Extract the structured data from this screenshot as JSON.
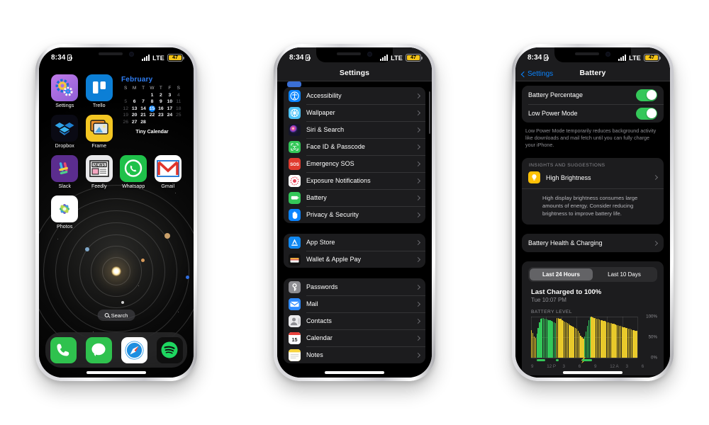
{
  "statusbar": {
    "time": "8:34",
    "carrier": "LTE",
    "battery_percent": "47",
    "lock_icon": "lock-icon"
  },
  "home": {
    "apps_row1": [
      {
        "label": "Settings",
        "icon": "settings-gears-icon"
      },
      {
        "label": "Trello",
        "icon": "trello-board-icon"
      }
    ],
    "apps_row2": [
      {
        "label": "Dropbox",
        "icon": "dropbox-box-icon"
      },
      {
        "label": "Frame",
        "icon": "frame-photos-icon"
      }
    ],
    "apps_row3": [
      {
        "label": "Slack",
        "icon": "slack-hash-icon"
      },
      {
        "label": "Feedly",
        "icon": "feedly-news-icon"
      },
      {
        "label": "Whatsapp",
        "icon": "whatsapp-phone-icon"
      },
      {
        "label": "Gmail",
        "icon": "gmail-envelope-icon"
      }
    ],
    "apps_row4": [
      {
        "label": "Photos",
        "icon": "photos-flower-icon"
      }
    ],
    "widget": {
      "caption": "Tiny Calendar",
      "month": "February",
      "dows": [
        "S",
        "M",
        "T",
        "W",
        "T",
        "F",
        "S"
      ],
      "weeks": [
        [
          {
            "d": "",
            "s": "blank"
          },
          {
            "d": "",
            "s": "blank"
          },
          {
            "d": "",
            "s": "blank"
          },
          {
            "d": "1",
            "s": "on"
          },
          {
            "d": "2",
            "s": "on"
          },
          {
            "d": "3",
            "s": "on"
          },
          {
            "d": "4",
            "s": "dim"
          }
        ],
        [
          {
            "d": "5",
            "s": "dim"
          },
          {
            "d": "6",
            "s": "on"
          },
          {
            "d": "7",
            "s": "on"
          },
          {
            "d": "8",
            "s": "on"
          },
          {
            "d": "9",
            "s": "on"
          },
          {
            "d": "10",
            "s": "on"
          },
          {
            "d": "11",
            "s": "dim"
          }
        ],
        [
          {
            "d": "12",
            "s": "dim"
          },
          {
            "d": "13",
            "s": "on"
          },
          {
            "d": "14",
            "s": "on"
          },
          {
            "d": "15",
            "s": "today"
          },
          {
            "d": "16",
            "s": "on"
          },
          {
            "d": "17",
            "s": "on"
          },
          {
            "d": "18",
            "s": "dim"
          }
        ],
        [
          {
            "d": "19",
            "s": "dim"
          },
          {
            "d": "20",
            "s": "on"
          },
          {
            "d": "21",
            "s": "on"
          },
          {
            "d": "22",
            "s": "on"
          },
          {
            "d": "23",
            "s": "on"
          },
          {
            "d": "24",
            "s": "on"
          },
          {
            "d": "25",
            "s": "dim"
          }
        ],
        [
          {
            "d": "26",
            "s": "dim"
          },
          {
            "d": "27",
            "s": "on"
          },
          {
            "d": "28",
            "s": "on"
          },
          {
            "d": "",
            "s": "blank"
          },
          {
            "d": "",
            "s": "blank"
          },
          {
            "d": "",
            "s": "blank"
          },
          {
            "d": "",
            "s": "blank"
          }
        ]
      ],
      "today": "15",
      "accent": "#0a84ff"
    },
    "search_label": "Search",
    "dock": [
      {
        "label": "Phone",
        "icon": "phone-icon"
      },
      {
        "label": "Messages",
        "icon": "messages-bubble-icon"
      },
      {
        "label": "Safari",
        "icon": "safari-compass-icon"
      },
      {
        "label": "Spotify",
        "icon": "spotify-icon"
      }
    ]
  },
  "settings": {
    "title": "Settings",
    "group1": [
      {
        "label": "Accessibility",
        "icon": "accessibility-icon",
        "color": "#0a84ff"
      },
      {
        "label": "Wallpaper",
        "icon": "wallpaper-icon",
        "color": "#4fc3f7"
      },
      {
        "label": "Siri & Search",
        "icon": "siri-icon",
        "color": "#1a1a2e"
      },
      {
        "label": "Face ID & Passcode",
        "icon": "faceid-icon",
        "color": "#34c759"
      },
      {
        "label": "Emergency SOS",
        "icon": "sos-icon",
        "color": "#e03b2f"
      },
      {
        "label": "Exposure Notifications",
        "icon": "exposure-notifications-icon",
        "color": "#ffffff"
      },
      {
        "label": "Battery",
        "icon": "battery-icon",
        "color": "#34c759"
      },
      {
        "label": "Privacy & Security",
        "icon": "privacy-hand-icon",
        "color": "#0a84ff"
      }
    ],
    "group2": [
      {
        "label": "App Store",
        "icon": "app-store-icon",
        "color": "#0a84ff"
      },
      {
        "label": "Wallet & Apple Pay",
        "icon": "wallet-icon",
        "color": "#1c1c1e"
      }
    ],
    "group3": [
      {
        "label": "Passwords",
        "icon": "passwords-key-icon",
        "color": "#8e8e93"
      },
      {
        "label": "Mail",
        "icon": "mail-icon",
        "color": "#2f8bff"
      },
      {
        "label": "Contacts",
        "icon": "contacts-icon",
        "color": "#b0b0b5"
      },
      {
        "label": "Calendar",
        "icon": "calendar-icon",
        "color": "#ffffff"
      },
      {
        "label": "Notes",
        "icon": "notes-icon",
        "color": "#ffd60a"
      }
    ]
  },
  "battery": {
    "back_label": "Settings",
    "title": "Battery",
    "toggles": [
      {
        "label": "Battery Percentage",
        "state": "on"
      },
      {
        "label": "Low Power Mode",
        "state": "on"
      }
    ],
    "footnote": "Low Power Mode temporarily reduces background activity like downloads and mail fetch until you can fully charge your iPhone.",
    "insights_header": "INSIGHTS AND SUGGESTIONS",
    "insight": {
      "icon": "lightbulb-icon",
      "title": "High Brightness",
      "body": "High display brightness consumes large amounts of energy. Consider reducing brightness to improve battery life."
    },
    "health_row": "Battery Health & Charging",
    "segments": [
      {
        "label": "Last 24 Hours",
        "active": true
      },
      {
        "label": "Last 10 Days",
        "active": false
      }
    ],
    "last_charged": "Last Charged to 100%",
    "last_charged_time": "Tue 10:07 PM",
    "chart_title": "BATTERY LEVEL",
    "colors": {
      "charging": "#34c759",
      "discharging": "#e8c92b",
      "toggle_on": "#34c759"
    }
  },
  "chart_data": {
    "type": "bar",
    "title": "BATTERY LEVEL",
    "xlabel": "",
    "ylabel": "",
    "ylim": [
      0,
      100
    ],
    "ytick_labels": [
      "100%",
      "50%",
      "0%"
    ],
    "ytick_values": [
      100,
      50,
      0
    ],
    "xtick_labels": [
      "9",
      "12 P",
      "3",
      "6",
      "9",
      "12 A",
      "3",
      "6"
    ],
    "grid": true,
    "legend": "none",
    "series": [
      {
        "name": "Battery level (%)",
        "values": [
          68,
          60,
          52,
          48,
          58,
          72,
          86,
          95,
          96,
          96,
          95,
          94,
          93,
          92,
          91,
          90,
          88,
          86,
          84,
          97,
          96,
          95,
          94,
          92,
          90,
          88,
          86,
          84,
          82,
          80,
          78,
          76,
          74,
          72,
          70,
          66,
          60,
          54,
          50,
          47,
          52,
          63,
          78,
          92,
          99,
          100,
          98,
          97,
          96,
          95,
          94,
          93,
          92,
          91,
          90,
          89,
          88,
          87,
          86,
          85,
          84,
          83,
          82,
          81,
          80,
          79,
          78,
          77,
          76,
          75,
          74,
          73,
          72,
          71,
          70,
          69,
          68,
          67,
          66,
          65
        ]
      },
      {
        "name": "Charging state",
        "values": [
          "d",
          "d",
          "d",
          "d",
          "c",
          "c",
          "c",
          "c",
          "c",
          "c",
          "c",
          "c",
          "c",
          "c",
          "c",
          "c",
          "c",
          "c",
          "c",
          "d",
          "d",
          "d",
          "d",
          "d",
          "d",
          "d",
          "d",
          "d",
          "d",
          "d",
          "d",
          "d",
          "d",
          "d",
          "d",
          "d",
          "d",
          "d",
          "d",
          "d",
          "c",
          "c",
          "c",
          "c",
          "c",
          "d",
          "d",
          "d",
          "d",
          "d",
          "d",
          "d",
          "d",
          "d",
          "d",
          "d",
          "d",
          "d",
          "d",
          "d",
          "d",
          "d",
          "d",
          "d",
          "d",
          "d",
          "d",
          "d",
          "d",
          "d",
          "d",
          "d",
          "d",
          "d",
          "d",
          "d",
          "d",
          "d",
          "d",
          "d"
        ]
      }
    ],
    "charge_marks": [
      {
        "start_pct": 5,
        "width_pct": 8
      },
      {
        "start_pct": 23,
        "width_pct": 3
      },
      {
        "start_pct": 48,
        "width_pct": 9
      }
    ]
  }
}
